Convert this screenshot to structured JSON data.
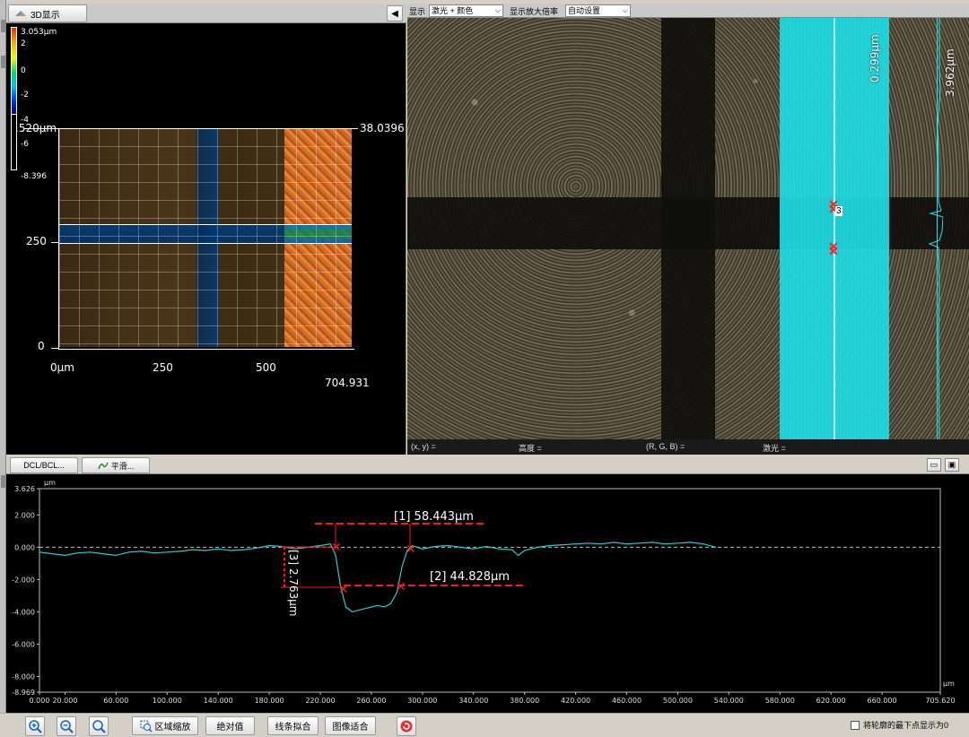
{
  "left_panel": {
    "tab_label": "3D显示",
    "collapse_glyph": "◀",
    "scale": {
      "top": "3.053µm",
      "v2": "2",
      "v0": "0",
      "vm2": "-2",
      "vm4": "-4",
      "vm6": "-6",
      "bottom": "-8.396"
    },
    "axes": {
      "y_top_label": ".520µm",
      "y_top_right_label": "38.0396",
      "y_250": "250",
      "y_0": "0",
      "x_0": "0µm",
      "x_250": "250",
      "x_500": "500",
      "x_max": "704.931"
    }
  },
  "image_panel": {
    "toolbar": {
      "display_label": "显示",
      "display_mode": "激光 + 颜色",
      "magnification_label": "显示放大倍率",
      "magnification_value": "自动设置"
    },
    "labels": {
      "profile_height": "0.299µm",
      "profile_right": "3.962µm",
      "marker_3": "3"
    },
    "status": {
      "xy": "(x, y) =",
      "height": "高度 =",
      "rgb": "(R, G, B) =",
      "laser": "激光 ="
    }
  },
  "bottom_panel": {
    "tabs": [
      {
        "label": "DCL/BCL..."
      },
      {
        "label": "平滑..."
      }
    ],
    "unit_top": "µm",
    "unit_right": "µm",
    "measurements": {
      "m1": "[1] 58.443µm",
      "m2": "[2] 44.828µm",
      "m3": "[3] 2.763µm"
    }
  },
  "chart_data": {
    "type": "line",
    "title": "",
    "xlabel": "µm",
    "ylabel": "µm",
    "xlim": [
      0.0,
      705.62
    ],
    "ylim": [
      -8.969,
      3.626
    ],
    "y_ticks": [
      "3.626",
      "2.000",
      "0.000",
      "-2.000",
      "-4.000",
      "-6.000",
      "-8.000",
      "-8.969"
    ],
    "x_ticks": [
      "0.000",
      "20.000",
      "60.000",
      "100.000",
      "140.000",
      "180.000",
      "220.000",
      "260.000",
      "300.000",
      "340.000",
      "380.000",
      "420.000",
      "460.000",
      "500.000",
      "540.000",
      "580.000",
      "620.000",
      "660.000",
      "705.620"
    ],
    "reference_line": 0.0,
    "series": [
      {
        "x": [
          0,
          10,
          20,
          30,
          40,
          50,
          60,
          70,
          80,
          90,
          100,
          110,
          120,
          130,
          140,
          150,
          160,
          170,
          180,
          190,
          200,
          210,
          220,
          228,
          232,
          236,
          240,
          245,
          250,
          255,
          260,
          265,
          270,
          275,
          280,
          284,
          288,
          292,
          296,
          300,
          310,
          320,
          330,
          340,
          350,
          360,
          370,
          375,
          380,
          390,
          400,
          410,
          420,
          430,
          440,
          450,
          460,
          470,
          480,
          490,
          500,
          510,
          520,
          530
        ],
        "y": [
          -0.3,
          -0.4,
          -0.5,
          -0.35,
          -0.3,
          -0.4,
          -0.5,
          -0.3,
          -0.25,
          -0.35,
          -0.3,
          -0.25,
          -0.15,
          -0.2,
          -0.1,
          -0.2,
          -0.15,
          -0.05,
          0.1,
          0.05,
          -0.1,
          0.0,
          0.1,
          0.2,
          -0.5,
          -2.5,
          -3.7,
          -4.0,
          -3.9,
          -3.8,
          -3.7,
          -3.6,
          -3.7,
          -3.5,
          -2.8,
          -1.2,
          -0.2,
          0.1,
          0.0,
          -0.1,
          0.05,
          0.1,
          0.0,
          -0.1,
          0.05,
          -0.1,
          -0.15,
          -0.5,
          -0.2,
          0.0,
          0.1,
          0.15,
          0.2,
          0.25,
          0.2,
          0.3,
          0.2,
          0.25,
          0.3,
          0.2,
          0.25,
          0.3,
          0.2,
          0.0
        ]
      }
    ]
  },
  "toolbar": {
    "zoom_region": "区域缩放",
    "absolute": "绝对值",
    "line_fit": "线条拟合",
    "image_fit": "图像适合",
    "show_lowest_zero": "将轮廓的最下点显示为0"
  }
}
